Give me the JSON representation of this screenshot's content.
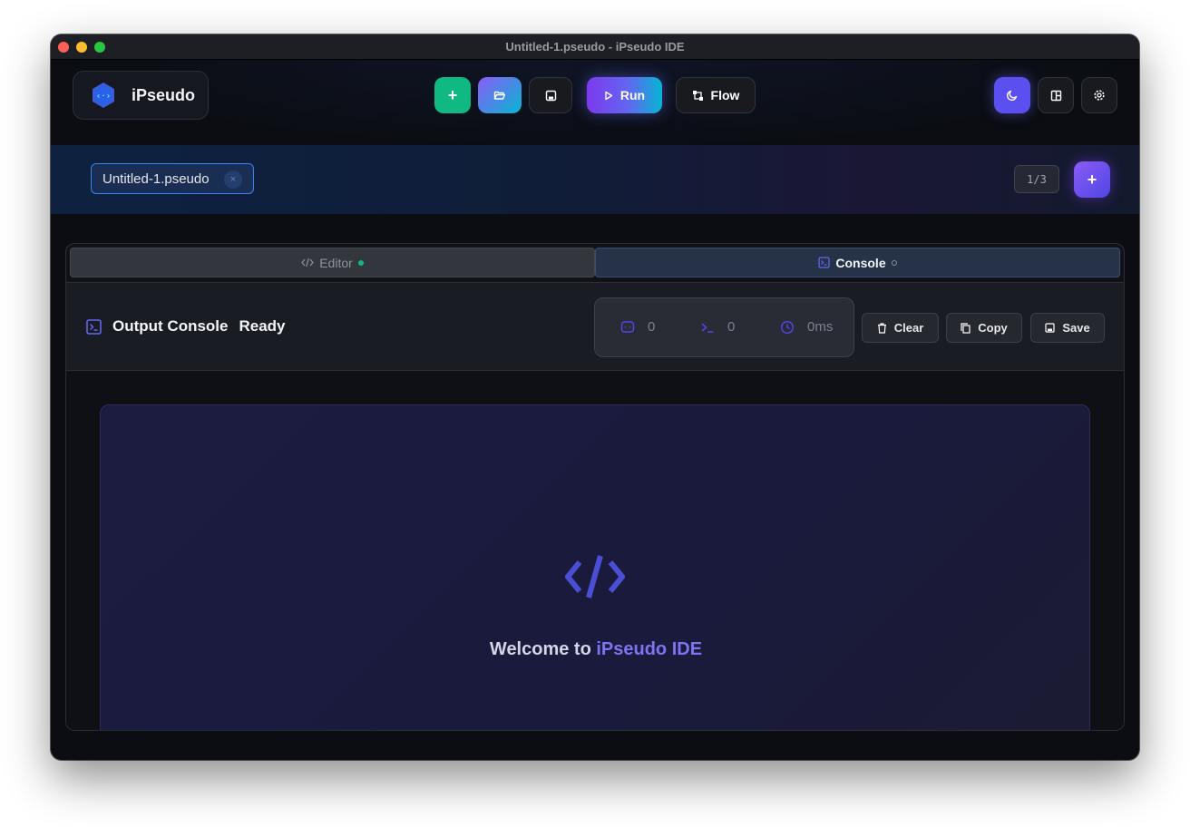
{
  "window": {
    "title": "Untitled-1.pseudo - iPseudo IDE"
  },
  "brand": {
    "name": "iPseudo"
  },
  "toolbar": {
    "new_label": "+",
    "run_label": "Run",
    "flow_label": "Flow"
  },
  "tabs": {
    "files": [
      {
        "label": "Untitled-1.pseudo",
        "close": "×"
      }
    ],
    "count": "1/3",
    "add_label": "+"
  },
  "view_tabs": [
    {
      "label": "Editor",
      "status": "green"
    },
    {
      "label": "Console",
      "status": "idle",
      "active": true
    }
  ],
  "console": {
    "title": "Output Console",
    "status": "Ready",
    "stats": {
      "lines": "0",
      "commands": "0",
      "time": "0ms"
    },
    "actions": {
      "clear": "Clear",
      "copy": "Copy",
      "save": "Save"
    }
  },
  "welcome": {
    "prefix": "Welcome to ",
    "accent": "iPseudo IDE"
  },
  "colors": {
    "accent": "#6366f1",
    "success": "#10b981",
    "brand_blue": "#3b82f6"
  }
}
